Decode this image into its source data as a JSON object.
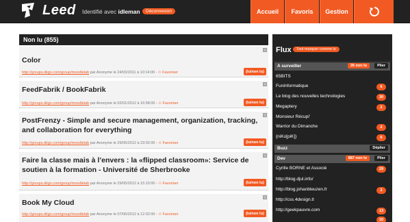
{
  "header": {
    "brand": "Leed",
    "identity_prefix": "Identifié avec",
    "username": "idleman",
    "logout_label": "Déconnexion",
    "nav": [
      {
        "label": "Accueil"
      },
      {
        "label": "Favoris"
      },
      {
        "label": "Gestion"
      }
    ],
    "refresh_icon": "refresh-icon"
  },
  "main": {
    "heading": "Non lu (855)",
    "articles": [
      {
        "title": "Color",
        "link": "http://groups.diigo.com/group/moodlelab",
        "author": "par Anonyme le 24/03/2011 à 10:14:00",
        "favorite_label": "Favoriser",
        "unread_label": "(lu/non lu)"
      },
      {
        "title": "FeedFabrik / BookFabrik",
        "link": "http://groups.diigo.com/group/moodlelab",
        "author": "par Anonyme le 02/01/2012 à 16:58:00",
        "favorite_label": "Favoriser",
        "unread_label": "(lu/non lu)"
      },
      {
        "title": "PostFrenzy - Simple and secure management, organization, tracking, and collaboration for everything",
        "link": "http://groups.diigo.com/group/moodlelab",
        "author": "par Anonyme le 29/05/2012 à 23:02:00",
        "favorite_label": "Favoriser",
        "unread_label": "(lu/non lu)"
      },
      {
        "title": "Faire la classe mais à l’envers : la «flipped classroom»: Service de soutien à la formation - Université de Sherbrooke",
        "link": "http://groups.diigo.com/group/moodlelab",
        "author": "par Anonyme le 29/05/2012 à 15:10:00",
        "favorite_label": "Favoriser",
        "unread_label": "(lu/non lu)"
      },
      {
        "title": "Book My Cloud",
        "link": "http://groups.diigo.com/group/moodlelab",
        "author": "par Anonyme le 07/06/2012 à 12:02:00",
        "favorite_label": "Favoriser",
        "unread_label": "(lu/non lu)"
      }
    ]
  },
  "sidebar": {
    "title": "Flux",
    "mark_all_label": "Tout marquer comme lu",
    "folders": [
      {
        "name": "A surveiller",
        "count": "26 non lu",
        "toggle": "Plier"
      },
      {
        "name": "Buzz",
        "toggle": "Déplier"
      },
      {
        "name": "Dev",
        "count": "887 non lu",
        "toggle": "Plier"
      }
    ],
    "feeds": [
      {
        "name": "65BITS",
        "count": ""
      },
      {
        "name": "FunInformatique",
        "count": "6"
      },
      {
        "name": "Le blog des nouvelles technologies",
        "count": "30"
      },
      {
        "name": "Megaptery",
        "count": "2"
      },
      {
        "name": "Monsieur Récupi'",
        "count": ""
      },
      {
        "name": "Warrior du Dimanche",
        "count": "2"
      },
      {
        "name": "{niKo[piK]}",
        "count": "6"
      },
      {
        "name": "Cyrille BORNE et Associé",
        "count": "29"
      },
      {
        "name": "http://blog.djul.info/",
        "count": ""
      },
      {
        "name": "http://blog.johanbleuzen.fr",
        "count": "2"
      },
      {
        "name": "http://css.4design.tl",
        "count": ""
      },
      {
        "name": "http://geekpauvre.com",
        "count": "13"
      },
      {
        "name": "",
        "count": "10"
      }
    ]
  }
}
